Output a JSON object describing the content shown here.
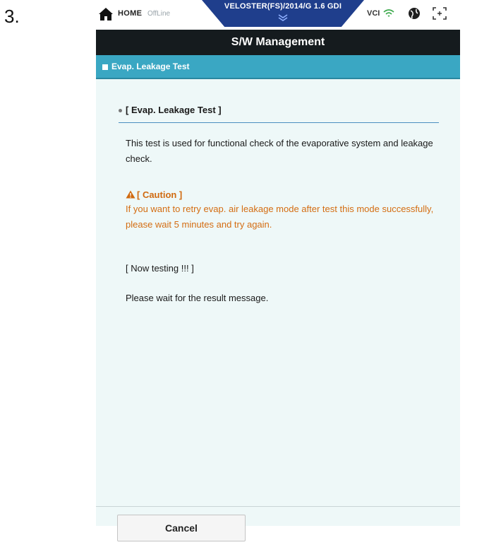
{
  "step": {
    "number": "3."
  },
  "topbar": {
    "home_label": "HOME",
    "status_label": "OffLine",
    "vehicle_label": "VELOSTER(FS)/2014/G 1.6 GDI",
    "vci_label": "VCI",
    "icons": [
      "home-icon",
      "chevron-down-icon",
      "wifi-icon",
      "globe-icon",
      "screen-icon"
    ]
  },
  "title": "S/W Management",
  "section": {
    "label": "Evap. Leakage Test"
  },
  "content": {
    "heading": "[ Evap. Leakage Test ]",
    "description": "This test is used for functional check of the evaporative system and leakage check.",
    "caution_title": "[ Caution ]",
    "caution_text": "If you want to retry evap. air leakage mode after test this mode successfully, please wait 5 minutes and try again.",
    "now_testing": "[ Now testing !!! ]",
    "wait_message": "Please wait for the result message."
  },
  "footer": {
    "cancel_label": "Cancel"
  },
  "colors": {
    "titlebar": "#151b1e",
    "sectionbar": "#3aa7c3",
    "vehicle_tab": "#1f3e8c",
    "caution": "#d46d12",
    "content_bg": "#eef8f8"
  }
}
